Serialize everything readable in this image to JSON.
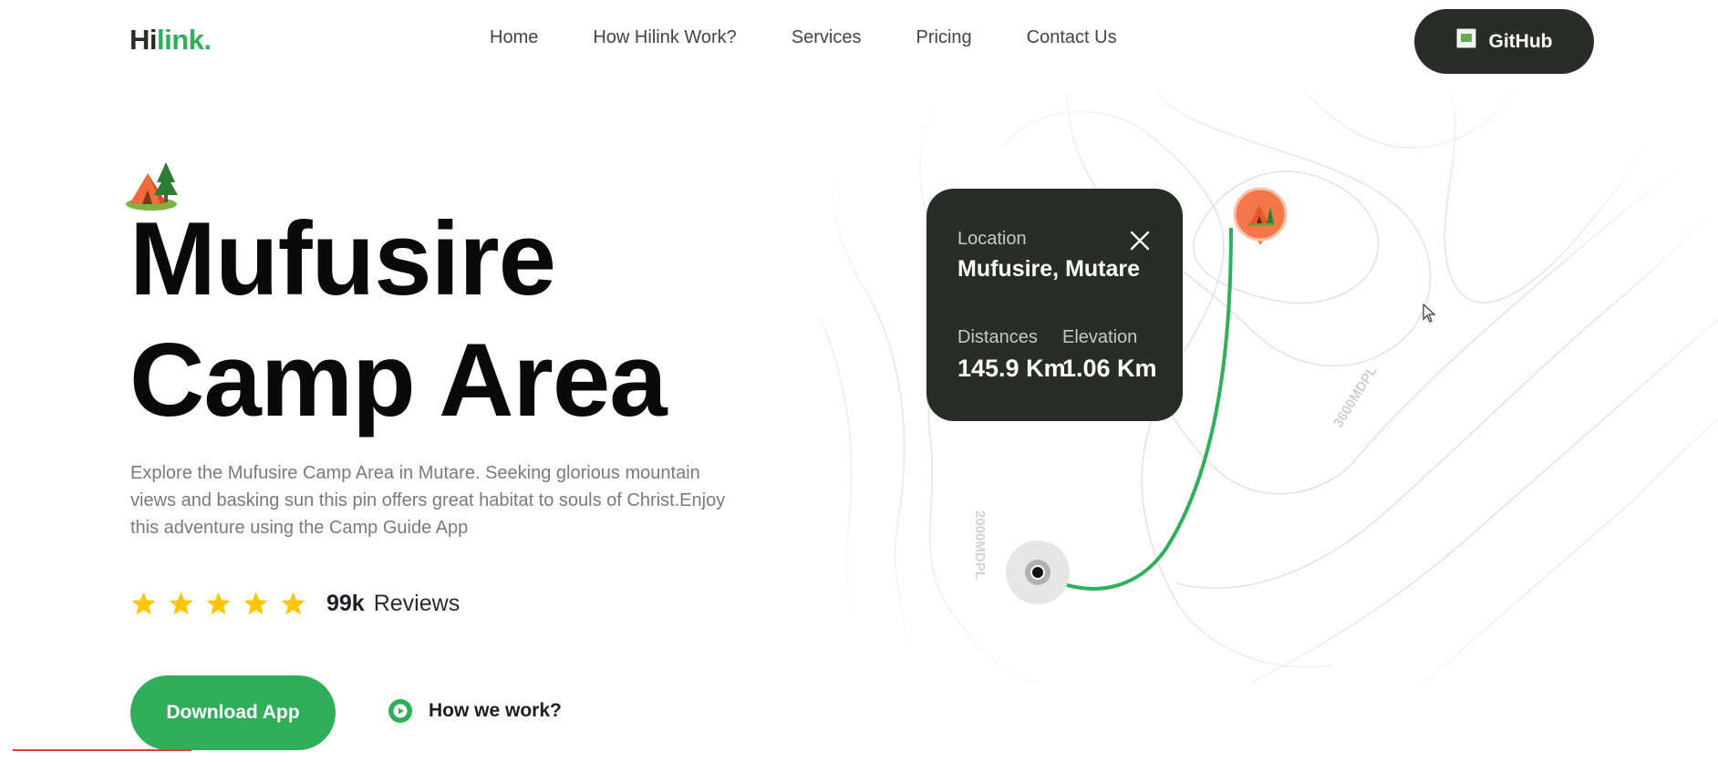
{
  "header": {
    "logo_hi": "Hi",
    "logo_rest": "link.",
    "nav": [
      "Home",
      "How Hilink Work?",
      "Services",
      "Pricing",
      "Contact Us"
    ],
    "github_label": "GitHub"
  },
  "hero": {
    "title_line1": "Mufusire",
    "title_line2": "Camp Area",
    "description": "Explore the Mufusire Camp Area in Mutare. Seeking glorious mountain views and basking sun this pin offers great habitat to souls of Christ.Enjoy this adventure using the Camp Guide App",
    "rating_stars": 5,
    "reviews_count": "99k",
    "reviews_label": "Reviews",
    "download_label": "Download App",
    "how_label": "How we work?"
  },
  "map": {
    "contour_label_1": "2000MDPL",
    "contour_label_2": "3600MDPL",
    "route_color": "#30af5b",
    "card": {
      "location_label": "Location",
      "location_value": "Mufusire, Mutare",
      "distance_label": "Distances",
      "distance_value": "145.9 Km",
      "elevation_label": "Elevation",
      "elevation_value": "1.06 Km"
    }
  },
  "colors": {
    "brand_green": "#30af5b",
    "dark": "#292c27",
    "star": "#fec601",
    "pin": "#f2784b"
  }
}
